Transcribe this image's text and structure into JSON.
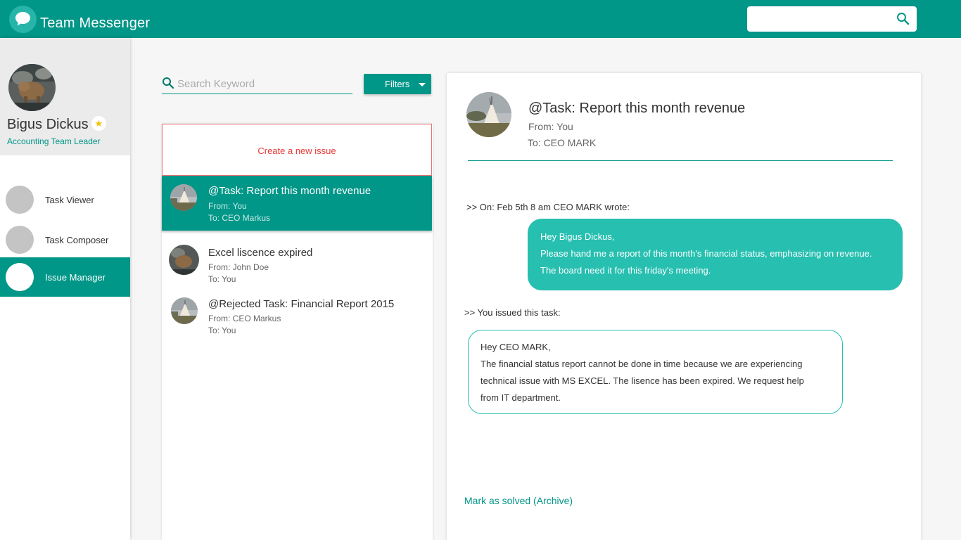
{
  "app": {
    "title": "Team Messenger"
  },
  "header": {
    "search_placeholder": ""
  },
  "profile": {
    "name": "Bigus Dickus",
    "role": "Accounting Team Leader",
    "star": "★"
  },
  "sidebar": {
    "items": [
      {
        "label": "Task Viewer",
        "active": false
      },
      {
        "label": "Task Composer",
        "active": false
      },
      {
        "label": "Issue Manager",
        "active": true
      }
    ]
  },
  "list": {
    "search_placeholder": "Search Keyword",
    "filters_label": "Filters",
    "create_label": "Create a new issue",
    "issues": [
      {
        "title": "@Task: Report this month revenue",
        "from": "From: You",
        "to": "To: CEO Markus",
        "selected": true
      },
      {
        "title": "Excel liscence expired",
        "from": "From: John Doe",
        "to": "To: You",
        "selected": false
      },
      {
        "title": "@Rejected Task: Financial Report 2015",
        "from": "From: CEO Markus",
        "to": "To: You",
        "selected": false
      }
    ]
  },
  "detail": {
    "title": "@Task: Report this month revenue",
    "from": "From: You",
    "to": "To: CEO MARK",
    "quote_header": ">> On: Feb 5th 8 am CEO MARK wrote:",
    "incoming": {
      "line1": "Hey Bigus Dickus,",
      "line2": "Please hand me a report of this month's financial status, emphasizing on revenue.",
      "line3": "The board need it for this friday's meeting."
    },
    "issued_header": ">> You issued this task:",
    "outgoing": {
      "line1": "Hey CEO MARK,",
      "line2": "The financial status report cannot be done in time because we are experiencing",
      "line3": "technical issue with MS EXCEL. The lisence has been expired. We request help",
      "line4": "from IT department."
    },
    "archive_label": "Mark as solved (Archive)"
  },
  "colors": {
    "primary": "#009688",
    "bubble": "#26bfb0",
    "danger": "#e53935"
  }
}
